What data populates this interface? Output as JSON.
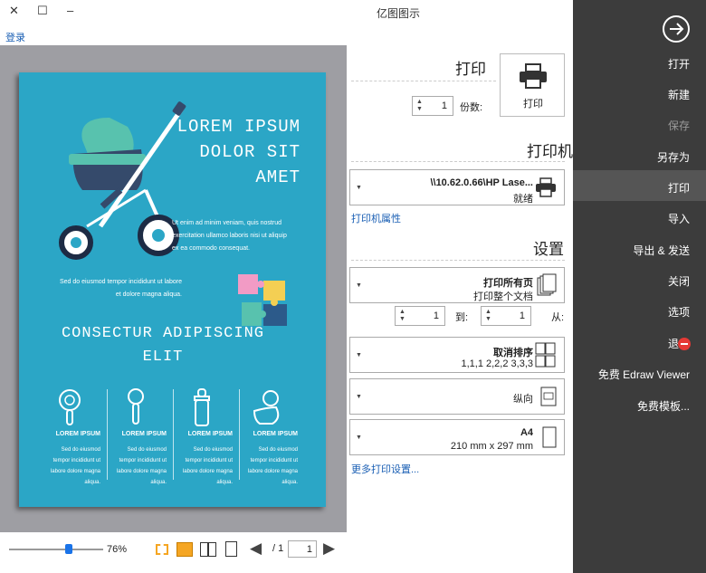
{
  "window": {
    "title": "亿图图示",
    "close": "✕",
    "maximize": "☐",
    "minimize": "–"
  },
  "login": "登录",
  "preview": {
    "title_lines": [
      "LOREM IPSUM",
      "DOLOR SIT",
      "AMET"
    ],
    "para1": [
      "Ut enim ad minim veniam, quis nostrud",
      "exercitation ullamco laboris nisi ut aliquip",
      "ex ea commodo consequat."
    ],
    "para2": [
      "Sed do eiusmod tempor incididunt ut labore",
      "et dolore magna aliqua."
    ],
    "subtitle_lines": [
      "CONSECTUR ADIPISCING",
      "ELIT"
    ],
    "columns": [
      {
        "heading": "LOREM IPSUM",
        "text": [
          "Sed do eiusmod",
          "tempor incididunt ut",
          "labore dolore magna",
          "aliqua."
        ]
      },
      {
        "heading": "LOREM IPSUM",
        "text": [
          "Sed do eiusmod",
          "tempor incididunt ut",
          "labore dolore magna",
          "aliqua."
        ]
      },
      {
        "heading": "LOREM IPSUM",
        "text": [
          "Sed do eiusmod",
          "tempor incididunt ut",
          "labore dolore magna",
          "aliqua."
        ]
      },
      {
        "heading": "LOREM IPSUM",
        "text": [
          "Sed do eiusmod",
          "tempor incididunt ut",
          "labore dolore magna",
          "aliqua."
        ]
      }
    ]
  },
  "bottombar": {
    "zoom": "76%",
    "page_current": "1",
    "page_total": "/ 1"
  },
  "print": {
    "section_title": "打印",
    "print_button": "打印",
    "copies_label": "份数:",
    "copies_value": "1"
  },
  "printer": {
    "section_title": "打印机",
    "name": "\\\\10.62.0.66\\HP Lase...",
    "status": "就绪",
    "properties_link": "打印机属性"
  },
  "settings": {
    "section_title": "设置",
    "pages_title": "打印所有页",
    "pages_sub": "打印整个文档",
    "from_label": "从:",
    "from_value": "1",
    "to_label": "到:",
    "to_value": "1",
    "collate_title": "取消排序",
    "collate_sub": "1,1,1  2,2,2  3,3,3",
    "orientation": "纵向",
    "paper_title": "A4",
    "paper_sub": "210 mm x 297 mm",
    "more_link": "更多打印设置..."
  },
  "sidebar": {
    "items": [
      {
        "label": "打开",
        "dim": false
      },
      {
        "label": "新建",
        "dim": false
      },
      {
        "label": "保存",
        "dim": true
      },
      {
        "label": "另存为",
        "dim": false
      },
      {
        "label": "打印",
        "dim": false
      },
      {
        "label": "导入",
        "dim": false
      },
      {
        "label": "导出 & 发送",
        "dim": false
      },
      {
        "label": "关闭",
        "dim": false
      },
      {
        "label": "选项",
        "dim": false
      },
      {
        "label": "退出",
        "dim": false
      },
      {
        "label": "免费 Edraw Viewer",
        "dim": false
      },
      {
        "label": "免费模板...",
        "dim": false
      }
    ]
  },
  "colors": {
    "page": "#2ba6c6",
    "sidebar": "#3c3c3c",
    "accent": "#f5a623",
    "exit": "#e53935"
  }
}
